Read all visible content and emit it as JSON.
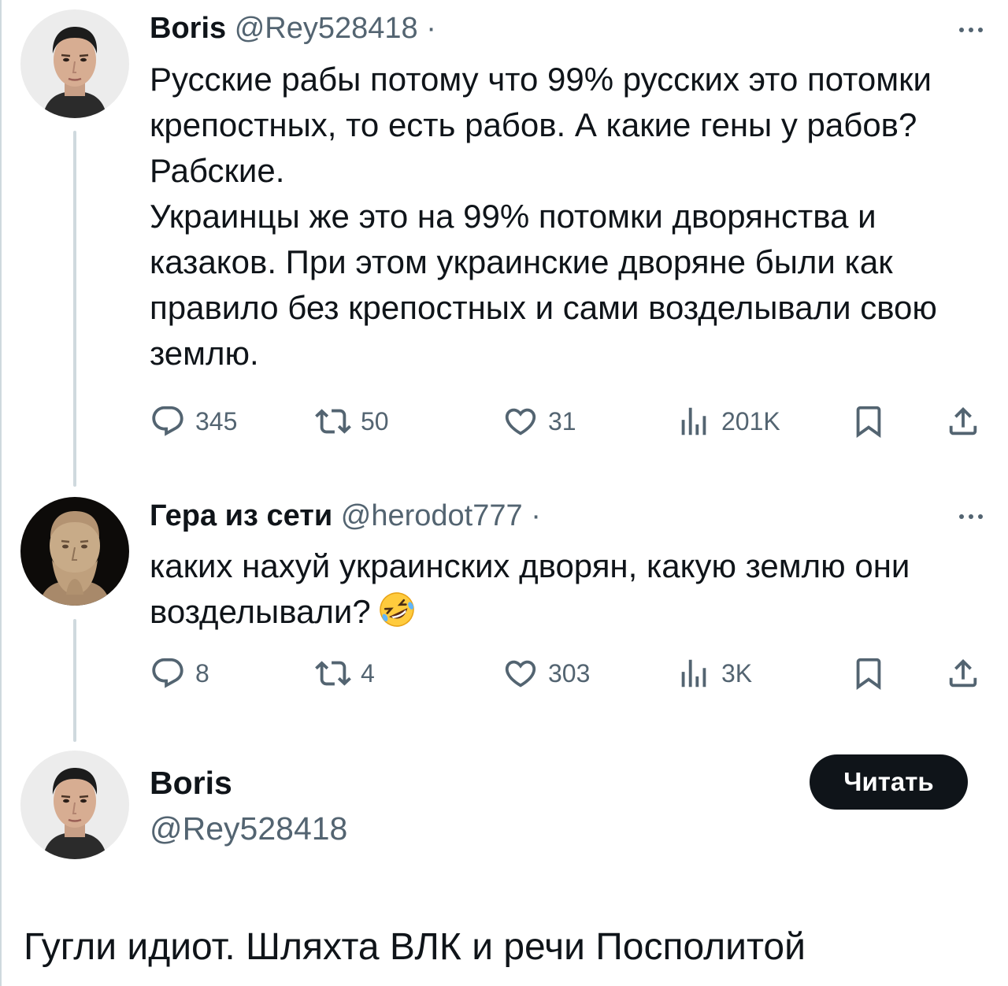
{
  "tweets": [
    {
      "name": "Boris",
      "handle": "@Rey528418",
      "dot": "·",
      "paragraphs": [
        "Русские рабы потому что 99% русских это потомки крепостных, то есть рабов. А какие гены у рабов? Рабские.",
        "Украинцы же это на 99% потомки дворянства и казаков. При этом украинские дворяне были как правило без крепостных и сами возделывали свою землю."
      ],
      "replies": "345",
      "retweets": "50",
      "likes": "31",
      "views": "201K"
    },
    {
      "name": "Гера из сети",
      "handle": "@herodot777",
      "dot": "·",
      "text": "каких нахуй украинских дворян, какую землю они возделывали?",
      "emoji": "rolling-on-floor-laughing-emoji",
      "replies": "8",
      "retweets": "4",
      "likes": "303",
      "views": "3K"
    }
  ],
  "main_post": {
    "name": "Boris",
    "handle": "@Rey528418",
    "follow_label": "Читать",
    "text": "Гугли идиот. Шляхта ВЛК и речи Посполитой"
  },
  "icons": {
    "reply": "reply-icon",
    "retweet": "retweet-icon",
    "like": "heart-icon",
    "views": "views-icon",
    "bookmark": "bookmark-icon",
    "share": "share-icon",
    "more": "more-icon"
  },
  "colors": {
    "text": "#0f1419",
    "secondary": "#536471",
    "thread_line": "#cfd9de",
    "button_bg": "#0f1419",
    "button_text": "#ffffff"
  }
}
